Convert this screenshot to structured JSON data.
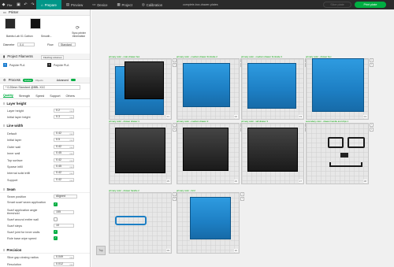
{
  "window": {
    "title": "complete-box-drawer-plates"
  },
  "menu": {
    "file": "File"
  },
  "tabs": [
    "Prepare",
    "Preview",
    "Device",
    "Project",
    "Calibration"
  ],
  "actions": {
    "slice": "Slice plate",
    "print": "Print plate"
  },
  "printer": {
    "header": "Printer",
    "name": "Bambu Lab X1 Carbon",
    "plate": "Smooth...",
    "sync": "Sync printer information",
    "diameter_label": "Diameter",
    "diameter": "0.4",
    "flow_label": "Flow",
    "flow": "Standard"
  },
  "filaments": {
    "header": "Project Filaments",
    "btn": "Flushing volumes",
    "items": [
      {
        "num": "1",
        "name": "PolyLite PLA"
      },
      {
        "num": "2",
        "name": "PolyLite PLA"
      }
    ]
  },
  "process": {
    "header": "Process",
    "global": "Global",
    "objects": "Objects",
    "advanced": "Advanced",
    "profile": "* 0.20mm Standard @BBL X1C",
    "subtabs": [
      "Quality",
      "Strength",
      "Speed",
      "Support",
      "Others"
    ]
  },
  "sections": {
    "layer_height": {
      "title": "Layer height",
      "rows": [
        {
          "label": "Layer height",
          "value": "0.2",
          "unit": "mm"
        },
        {
          "label": "Initial layer height",
          "value": "0.3",
          "unit": "mm"
        }
      ]
    },
    "line_width": {
      "title": "Line width",
      "rows": [
        {
          "label": "Default",
          "value": "0.42",
          "unit": "mm"
        },
        {
          "label": "Initial layer",
          "value": "0.5",
          "unit": "mm"
        },
        {
          "label": "Outer wall",
          "value": "0.42",
          "unit": "mm"
        },
        {
          "label": "Inner wall",
          "value": "0.45",
          "unit": "mm"
        },
        {
          "label": "Top surface",
          "value": "0.42",
          "unit": "mm"
        },
        {
          "label": "Sparse infill",
          "value": "0.45",
          "unit": "mm"
        },
        {
          "label": "Internal solid infill",
          "value": "0.42",
          "unit": "mm"
        },
        {
          "label": "Support",
          "value": "0.42",
          "unit": "mm"
        }
      ]
    },
    "seam": {
      "title": "Seam",
      "seam_position_label": "Seam position",
      "seam_position": "Aligned",
      "smart_scarf_label": "Smart scarf seam application",
      "scarf_threshold_label": "Scarf application angle threshold",
      "scarf_threshold": "155",
      "scarf_around_label": "Scarf around entire wall",
      "scarf_steps_label": "Scarf steps",
      "scarf_steps": "10",
      "scarf_inner_label": "Scarf joint for inner walls",
      "role_based_label": "Role base wipe speed"
    },
    "precision": {
      "title": "Precision",
      "rows": [
        {
          "label": "Slice gap closing radius",
          "value": "0.049",
          "unit": "mm"
        },
        {
          "label": "Resolution",
          "value": "0.012",
          "unit": "mm"
        }
      ]
    }
  },
  "plates": [
    {
      "num": "01",
      "label": "primary color - main drawer box"
    },
    {
      "num": "02",
      "label": "primary color - medium drawer frontside 2"
    },
    {
      "num": "03",
      "label": "primary color - medium drawer frontside 3"
    },
    {
      "num": "04",
      "label": "primary color - drawer box"
    },
    {
      "num": "05",
      "label": "primary color - drawer drawer 1"
    },
    {
      "num": "06",
      "label": "primary color - medium drawer 2"
    },
    {
      "num": "07",
      "label": "primary color - tall drawer 3"
    },
    {
      "num": "08",
      "label": "secondary color - drawer handle and clips 1"
    },
    {
      "num": "09",
      "label": "primary color - drawer handle 2"
    },
    {
      "num": "10",
      "label": "primary color - lid 2"
    }
  ],
  "view": {
    "top_label": "Top"
  }
}
